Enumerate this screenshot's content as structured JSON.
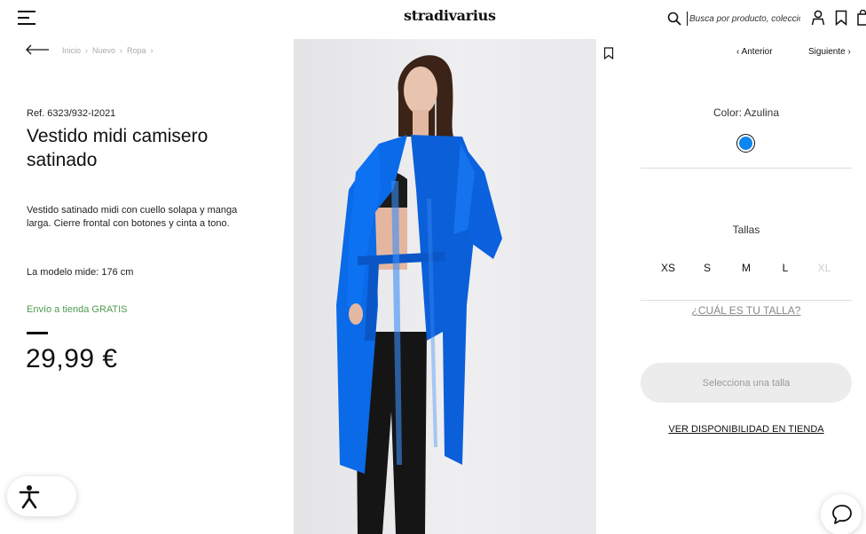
{
  "header": {
    "logo": "stradivarius",
    "search_placeholder": "Busca por producto, colección..."
  },
  "breadcrumb": [
    "Inicio",
    "Nuevo",
    "Ropa"
  ],
  "product": {
    "ref": "Ref. 6323/932-I2021",
    "title": "Vestido midi camisero satinado",
    "description": "Vestido satinado midi con cuello solapa y manga larga. Cierre frontal con botones y cinta a tono.",
    "model_info": "La modelo mide: 176 cm",
    "shipping": "Envío a tienda GRATIS",
    "price": "29,99 €"
  },
  "nav": {
    "prev": "Anterior",
    "next": "Siguiente"
  },
  "color": {
    "label": "Color: Azulina",
    "swatch_hex": "#0c86f0"
  },
  "sizes": {
    "label": "Tallas",
    "options": [
      {
        "label": "XS",
        "available": true
      },
      {
        "label": "S",
        "available": true
      },
      {
        "label": "M",
        "available": true
      },
      {
        "label": "L",
        "available": true
      },
      {
        "label": "XL",
        "available": false
      }
    ],
    "guide_link": "¿CUÁL ES TU TALLA?"
  },
  "cta": {
    "select_size": "Selecciona una talla",
    "store_availability": "VER DISPONIBILIDAD EN TIENDA"
  },
  "icons": {
    "menu": "hamburger-menu-icon",
    "search": "search-icon",
    "account": "user-icon",
    "wishlist": "bookmark-icon",
    "bag": "shopping-bag-icon",
    "accessibility": "accessibility-icon",
    "chat": "chat-bubble-icon"
  },
  "colors": {
    "accent_green": "#4d9a52",
    "dress_blue": "#0c86f0"
  }
}
